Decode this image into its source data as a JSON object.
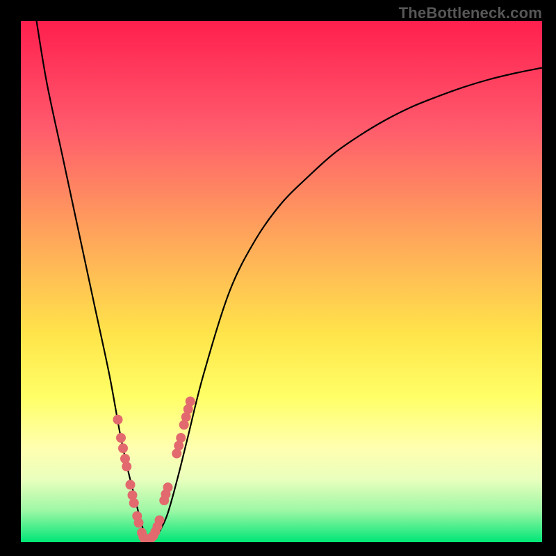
{
  "watermark": "TheBottleneck.com",
  "colors": {
    "frame": "#000000",
    "curve": "#000000",
    "dots": "#e26a6e",
    "gradient_stops": [
      {
        "offset": 0.0,
        "color": "#ff1f4e"
      },
      {
        "offset": 0.2,
        "color": "#ff596c"
      },
      {
        "offset": 0.4,
        "color": "#ffa15c"
      },
      {
        "offset": 0.6,
        "color": "#ffe44a"
      },
      {
        "offset": 0.72,
        "color": "#ffff66"
      },
      {
        "offset": 0.82,
        "color": "#ffffb0"
      },
      {
        "offset": 0.88,
        "color": "#e9ffbd"
      },
      {
        "offset": 0.94,
        "color": "#9cf7a5"
      },
      {
        "offset": 1.0,
        "color": "#00e676"
      }
    ]
  },
  "chart_data": {
    "type": "line",
    "title": "",
    "xlabel": "",
    "ylabel": "",
    "xlim": [
      0,
      100
    ],
    "ylim": [
      0,
      100
    ],
    "series": [
      {
        "name": "bottleneck-curve",
        "x": [
          3,
          5,
          8,
          11,
          14,
          17,
          19,
          20.5,
          22,
          23,
          24,
          25,
          26,
          28,
          30,
          32,
          35,
          40,
          45,
          50,
          55,
          60,
          65,
          70,
          75,
          80,
          85,
          90,
          95,
          100
        ],
        "y": [
          100,
          88,
          74,
          60,
          46,
          32,
          21,
          14,
          8,
          4,
          1,
          0,
          1,
          5,
          12,
          20,
          32,
          48,
          58,
          65,
          70,
          74.5,
          78,
          81,
          83.5,
          85.5,
          87.3,
          88.8,
          90,
          91
        ]
      }
    ],
    "dots": {
      "name": "overlay-dots",
      "x": [
        18.6,
        19.2,
        19.6,
        20.0,
        20.3,
        21.0,
        21.4,
        21.7,
        22.3,
        22.6,
        23.2,
        23.5,
        23.8,
        24.3,
        24.6,
        25.0,
        25.4,
        25.8,
        26.2,
        26.6,
        27.5,
        27.8,
        28.2,
        29.9,
        30.3,
        30.7,
        31.3,
        31.7,
        32.1,
        32.5
      ],
      "y": [
        23.5,
        20.0,
        18.0,
        16.0,
        14.5,
        11.0,
        9.0,
        7.5,
        5.0,
        3.7,
        1.8,
        1.0,
        0.5,
        0.3,
        0.5,
        0.8,
        1.2,
        2.0,
        3.0,
        4.2,
        8.0,
        9.2,
        10.5,
        17.0,
        18.5,
        20.0,
        22.5,
        24.0,
        25.5,
        27.0
      ]
    }
  }
}
